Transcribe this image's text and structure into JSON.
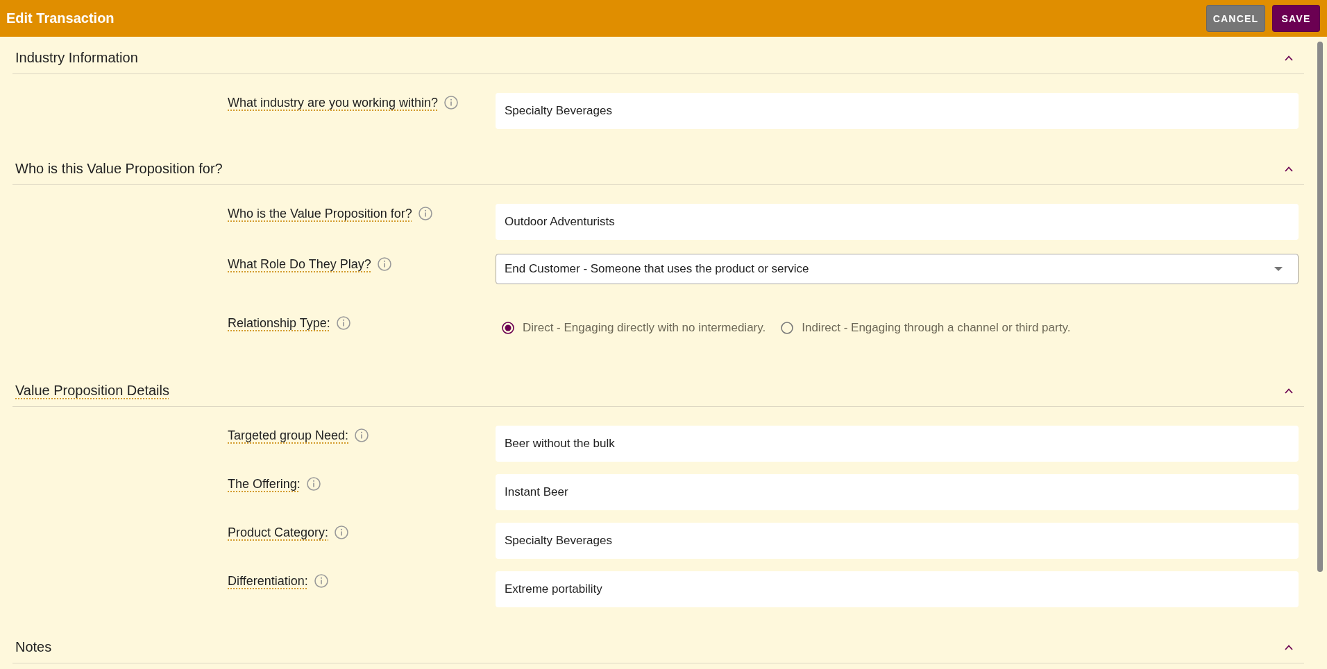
{
  "window": {
    "title": "Edit Transaction"
  },
  "header_buttons": [
    {
      "label": "CANCEL",
      "kind": "cancel"
    },
    {
      "label": "SAVE",
      "kind": "save"
    }
  ],
  "sections": [
    {
      "title": "Industry Information",
      "expanded": true,
      "tooltip": false,
      "fields": [
        {
          "kind": "text",
          "label": "What industry are you working within?",
          "value": "Specialty Beverages"
        }
      ]
    },
    {
      "title": "Who is this Value Proposition for?",
      "expanded": true,
      "tooltip": false,
      "fields": [
        {
          "kind": "text",
          "label": "Who is the Value Proposition for?",
          "value": "Outdoor Adventurists"
        },
        {
          "kind": "select",
          "label": "What Role Do They Play?",
          "value": "End Customer - Someone that uses the product or service"
        },
        {
          "kind": "radio",
          "label": "Relationship Type:",
          "options": [
            {
              "label": "Direct - Engaging directly with no intermediary.",
              "selected": true
            },
            {
              "label": "Indirect - Engaging through a channel or third party.",
              "selected": false
            }
          ]
        }
      ]
    },
    {
      "title": "Value Proposition Details",
      "expanded": true,
      "tooltip": true,
      "fields": [
        {
          "kind": "text",
          "label": "Targeted group Need:",
          "value": "Beer without the bulk"
        },
        {
          "kind": "text",
          "label": "The Offering:",
          "value": "Instant Beer"
        },
        {
          "kind": "text",
          "label": "Product Category:",
          "value": "Specialty Beverages"
        },
        {
          "kind": "text",
          "label": "Differentiation:",
          "value": "Extreme portability"
        }
      ]
    },
    {
      "title": "Notes",
      "expanded": true,
      "tooltip": false
    }
  ]
}
